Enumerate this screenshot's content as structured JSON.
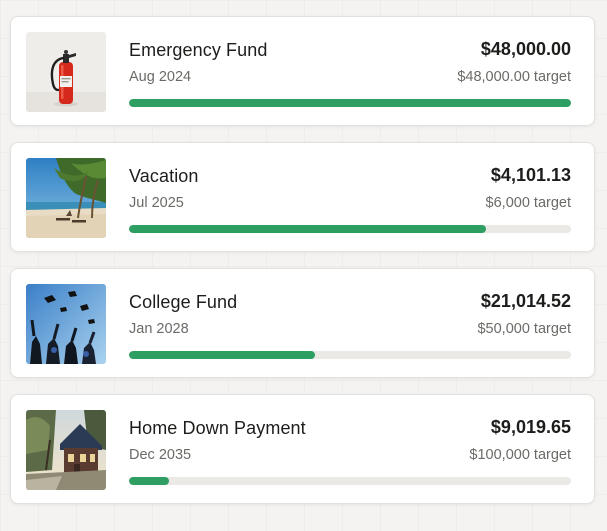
{
  "colors": {
    "progress_fill": "#2e9e63",
    "progress_track": "#ebe9e5",
    "card_background": "#ffffff"
  },
  "goals": [
    {
      "name": "Emergency Fund",
      "date": "Aug 2024",
      "amount": "$48,000.00",
      "target": "$48,000.00 target",
      "progress": 1.0,
      "image": "fire-extinguisher-image"
    },
    {
      "name": "Vacation",
      "date": "Jul 2025",
      "amount": "$4,101.13",
      "target": "$6,000 target",
      "progress": 0.8085,
      "image": "palm-beach-image"
    },
    {
      "name": "College Fund",
      "date": "Jan 2028",
      "amount": "$21,014.52",
      "target": "$50,000 target",
      "progress": 0.4203,
      "image": "graduation-caps-image"
    },
    {
      "name": "Home Down Payment",
      "date": "Dec 2035",
      "amount": "$9,019.65",
      "target": "$100,000 target",
      "progress": 0.0902,
      "image": "house-image"
    }
  ]
}
